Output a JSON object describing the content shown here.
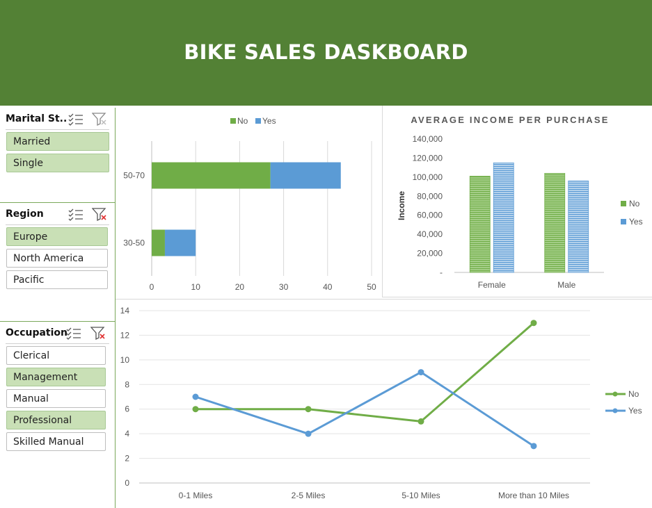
{
  "dashboard": {
    "title": "BIKE SALES DASKBOARD"
  },
  "slicers": {
    "marital": {
      "title": "Marital St...",
      "items": [
        {
          "label": "Married",
          "selected": true
        },
        {
          "label": "Single",
          "selected": true
        }
      ]
    },
    "region": {
      "title": "Region",
      "items": [
        {
          "label": "Europe",
          "selected": true
        },
        {
          "label": "North America",
          "selected": false
        },
        {
          "label": "Pacific",
          "selected": false
        }
      ]
    },
    "occupation": {
      "title": "Occupation",
      "items": [
        {
          "label": "Clerical",
          "selected": false
        },
        {
          "label": "Management",
          "selected": true
        },
        {
          "label": "Manual",
          "selected": false
        },
        {
          "label": "Professional",
          "selected": true
        },
        {
          "label": "Skilled Manual",
          "selected": false
        }
      ]
    }
  },
  "colors": {
    "banner": "#538135",
    "no": "#70AD47",
    "yes": "#5B9BD5",
    "selected_item": "#C9E0B6"
  },
  "icons": {
    "multi_select": "multi-select-icon",
    "clear_filter": "clear-filter-icon"
  },
  "chart_data": [
    {
      "type": "bar",
      "orientation": "horizontal",
      "stacked": true,
      "title": "",
      "categories": [
        "50-70",
        "30-50"
      ],
      "series": [
        {
          "name": "No",
          "values": [
            27,
            3
          ]
        },
        {
          "name": "Yes",
          "values": [
            16,
            7
          ]
        }
      ],
      "xlim": [
        0,
        50
      ],
      "xticks": [
        "0",
        "10",
        "20",
        "30",
        "40",
        "50"
      ],
      "grid": true,
      "legend": "top"
    },
    {
      "type": "bar",
      "title": "AVERAGE INCOME PER PURCHASE",
      "ylabel": "Income",
      "categories": [
        "Female",
        "Male"
      ],
      "series": [
        {
          "name": "No",
          "values": [
            101000,
            104000
          ]
        },
        {
          "name": "Yes",
          "values": [
            115000,
            96000
          ]
        }
      ],
      "ylim": [
        0,
        140000
      ],
      "yticks": [
        "-",
        "20,000",
        "40,000",
        "60,000",
        "80,000",
        "100,000",
        "120,000",
        "140,000"
      ],
      "grid": false,
      "legend": "right"
    },
    {
      "type": "line",
      "title": "",
      "categories": [
        "0-1 Miles",
        "2-5 Miles",
        "5-10 Miles",
        "More than 10 Miles"
      ],
      "series": [
        {
          "name": "No",
          "values": [
            6,
            6,
            5,
            13
          ]
        },
        {
          "name": "Yes",
          "values": [
            7,
            4,
            9,
            3
          ]
        }
      ],
      "ylim": [
        0,
        14
      ],
      "yticks": [
        "0",
        "2",
        "4",
        "6",
        "8",
        "10",
        "12",
        "14"
      ],
      "grid": true,
      "legend": "right"
    }
  ]
}
